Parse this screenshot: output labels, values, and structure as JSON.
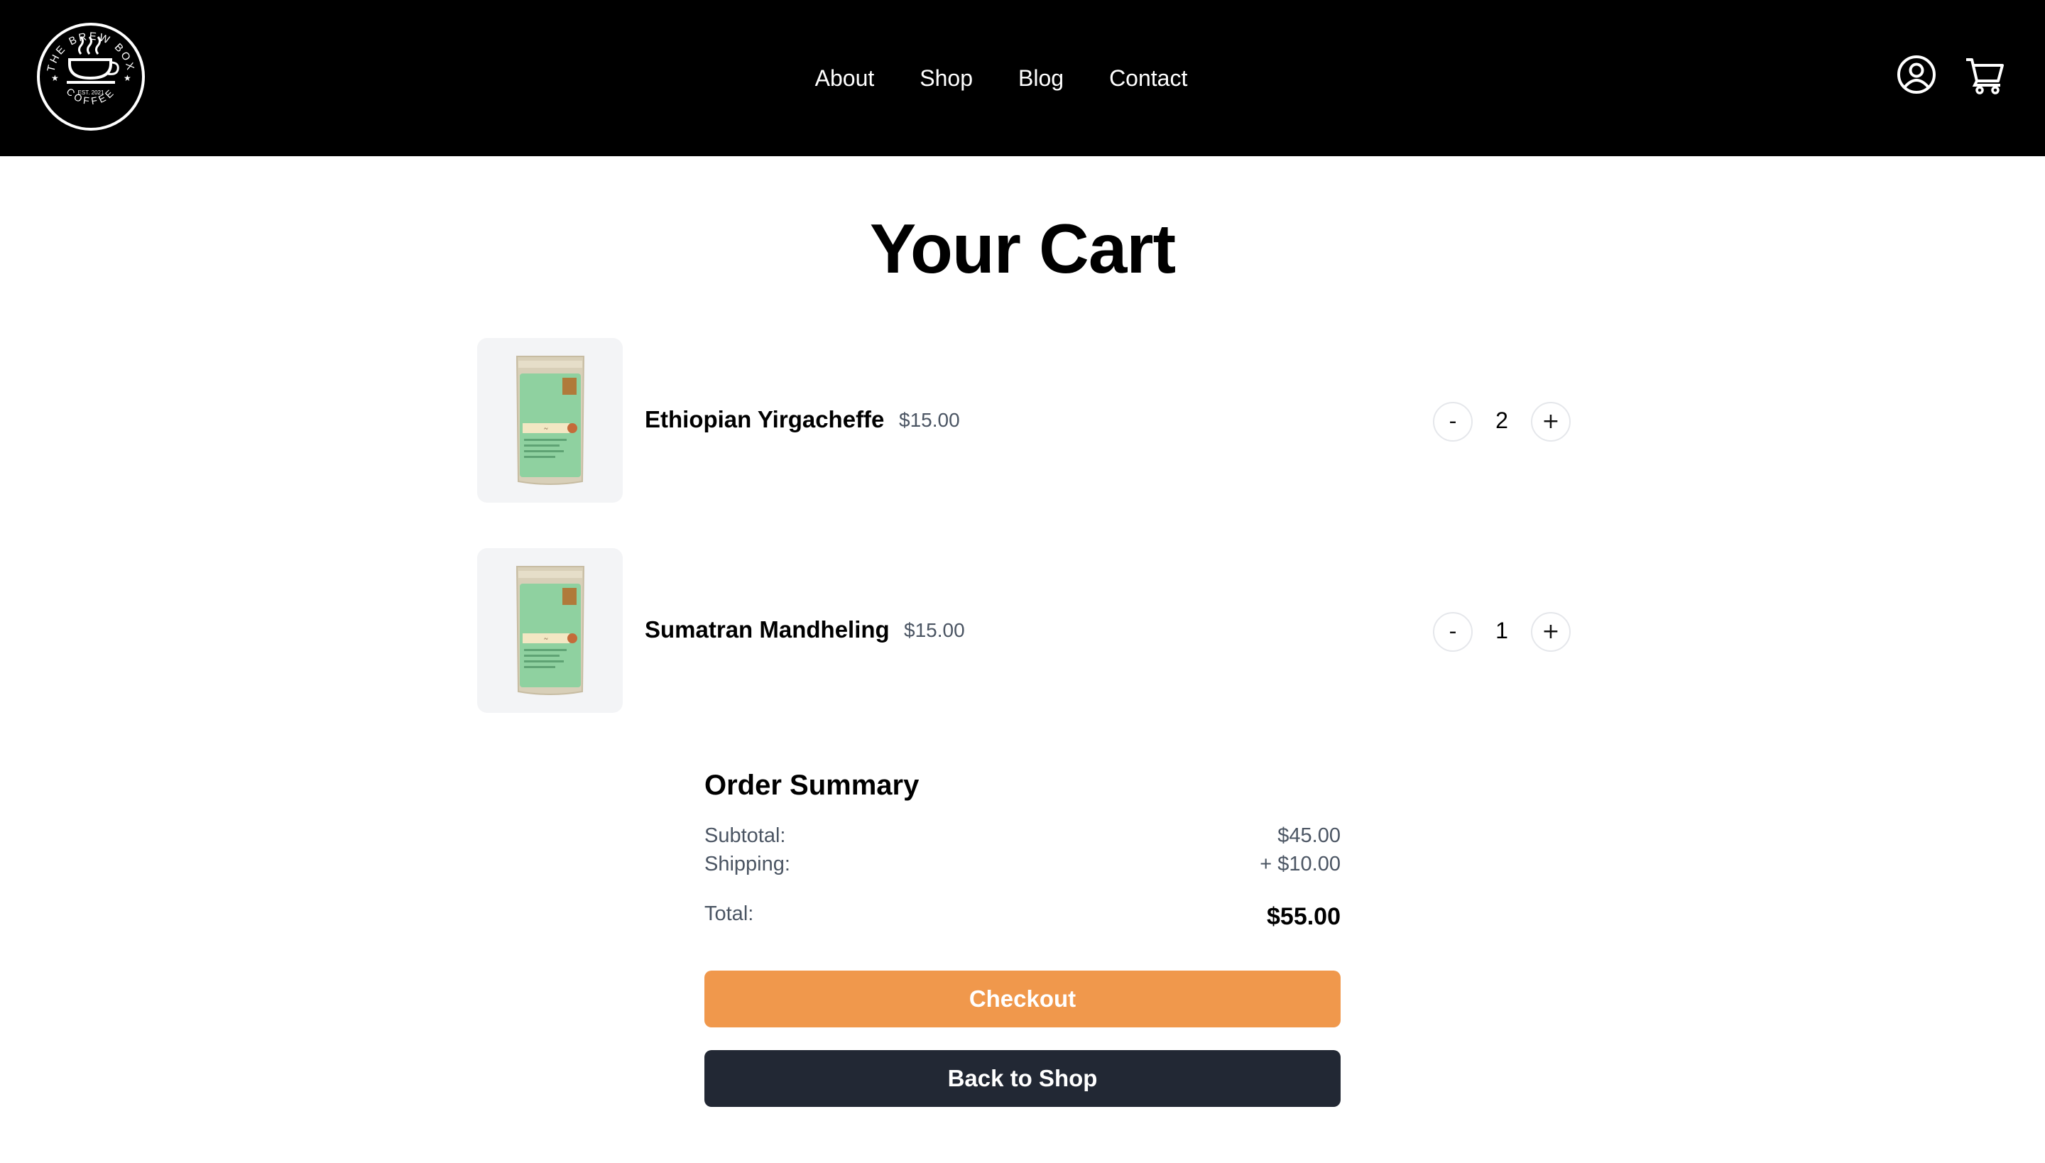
{
  "header": {
    "logo": {
      "arc_top": "THE BREW BOX",
      "arc_bottom": "COFFEE",
      "est": "EST. 2021"
    },
    "nav": [
      "About",
      "Shop",
      "Blog",
      "Contact"
    ],
    "icons": [
      "account-icon",
      "cart-icon"
    ]
  },
  "page": {
    "title": "Your Cart"
  },
  "cart": {
    "items": [
      {
        "name": "Ethiopian Yirgacheffe",
        "price": "$15.00",
        "quantity": "2",
        "minus": "-",
        "plus": "+",
        "image": "coffee-bag"
      },
      {
        "name": "Sumatran Mandheling",
        "price": "$15.00",
        "quantity": "1",
        "minus": "-",
        "plus": "+",
        "image": "coffee-bag"
      }
    ]
  },
  "summary": {
    "title": "Order Summary",
    "subtotal_label": "Subtotal:",
    "subtotal_value": "$45.00",
    "shipping_label": "Shipping:",
    "shipping_value": "+ $10.00",
    "total_label": "Total:",
    "total_value": "$55.00",
    "checkout_label": "Checkout",
    "back_label": "Back to Shop"
  },
  "colors": {
    "header_bg": "#000000",
    "checkout": "#f0984c",
    "back": "#222834",
    "thumb_bg": "#f3f4f6",
    "bag_green": "#8fd1a0",
    "bag_kraft": "#d8cfb8"
  }
}
